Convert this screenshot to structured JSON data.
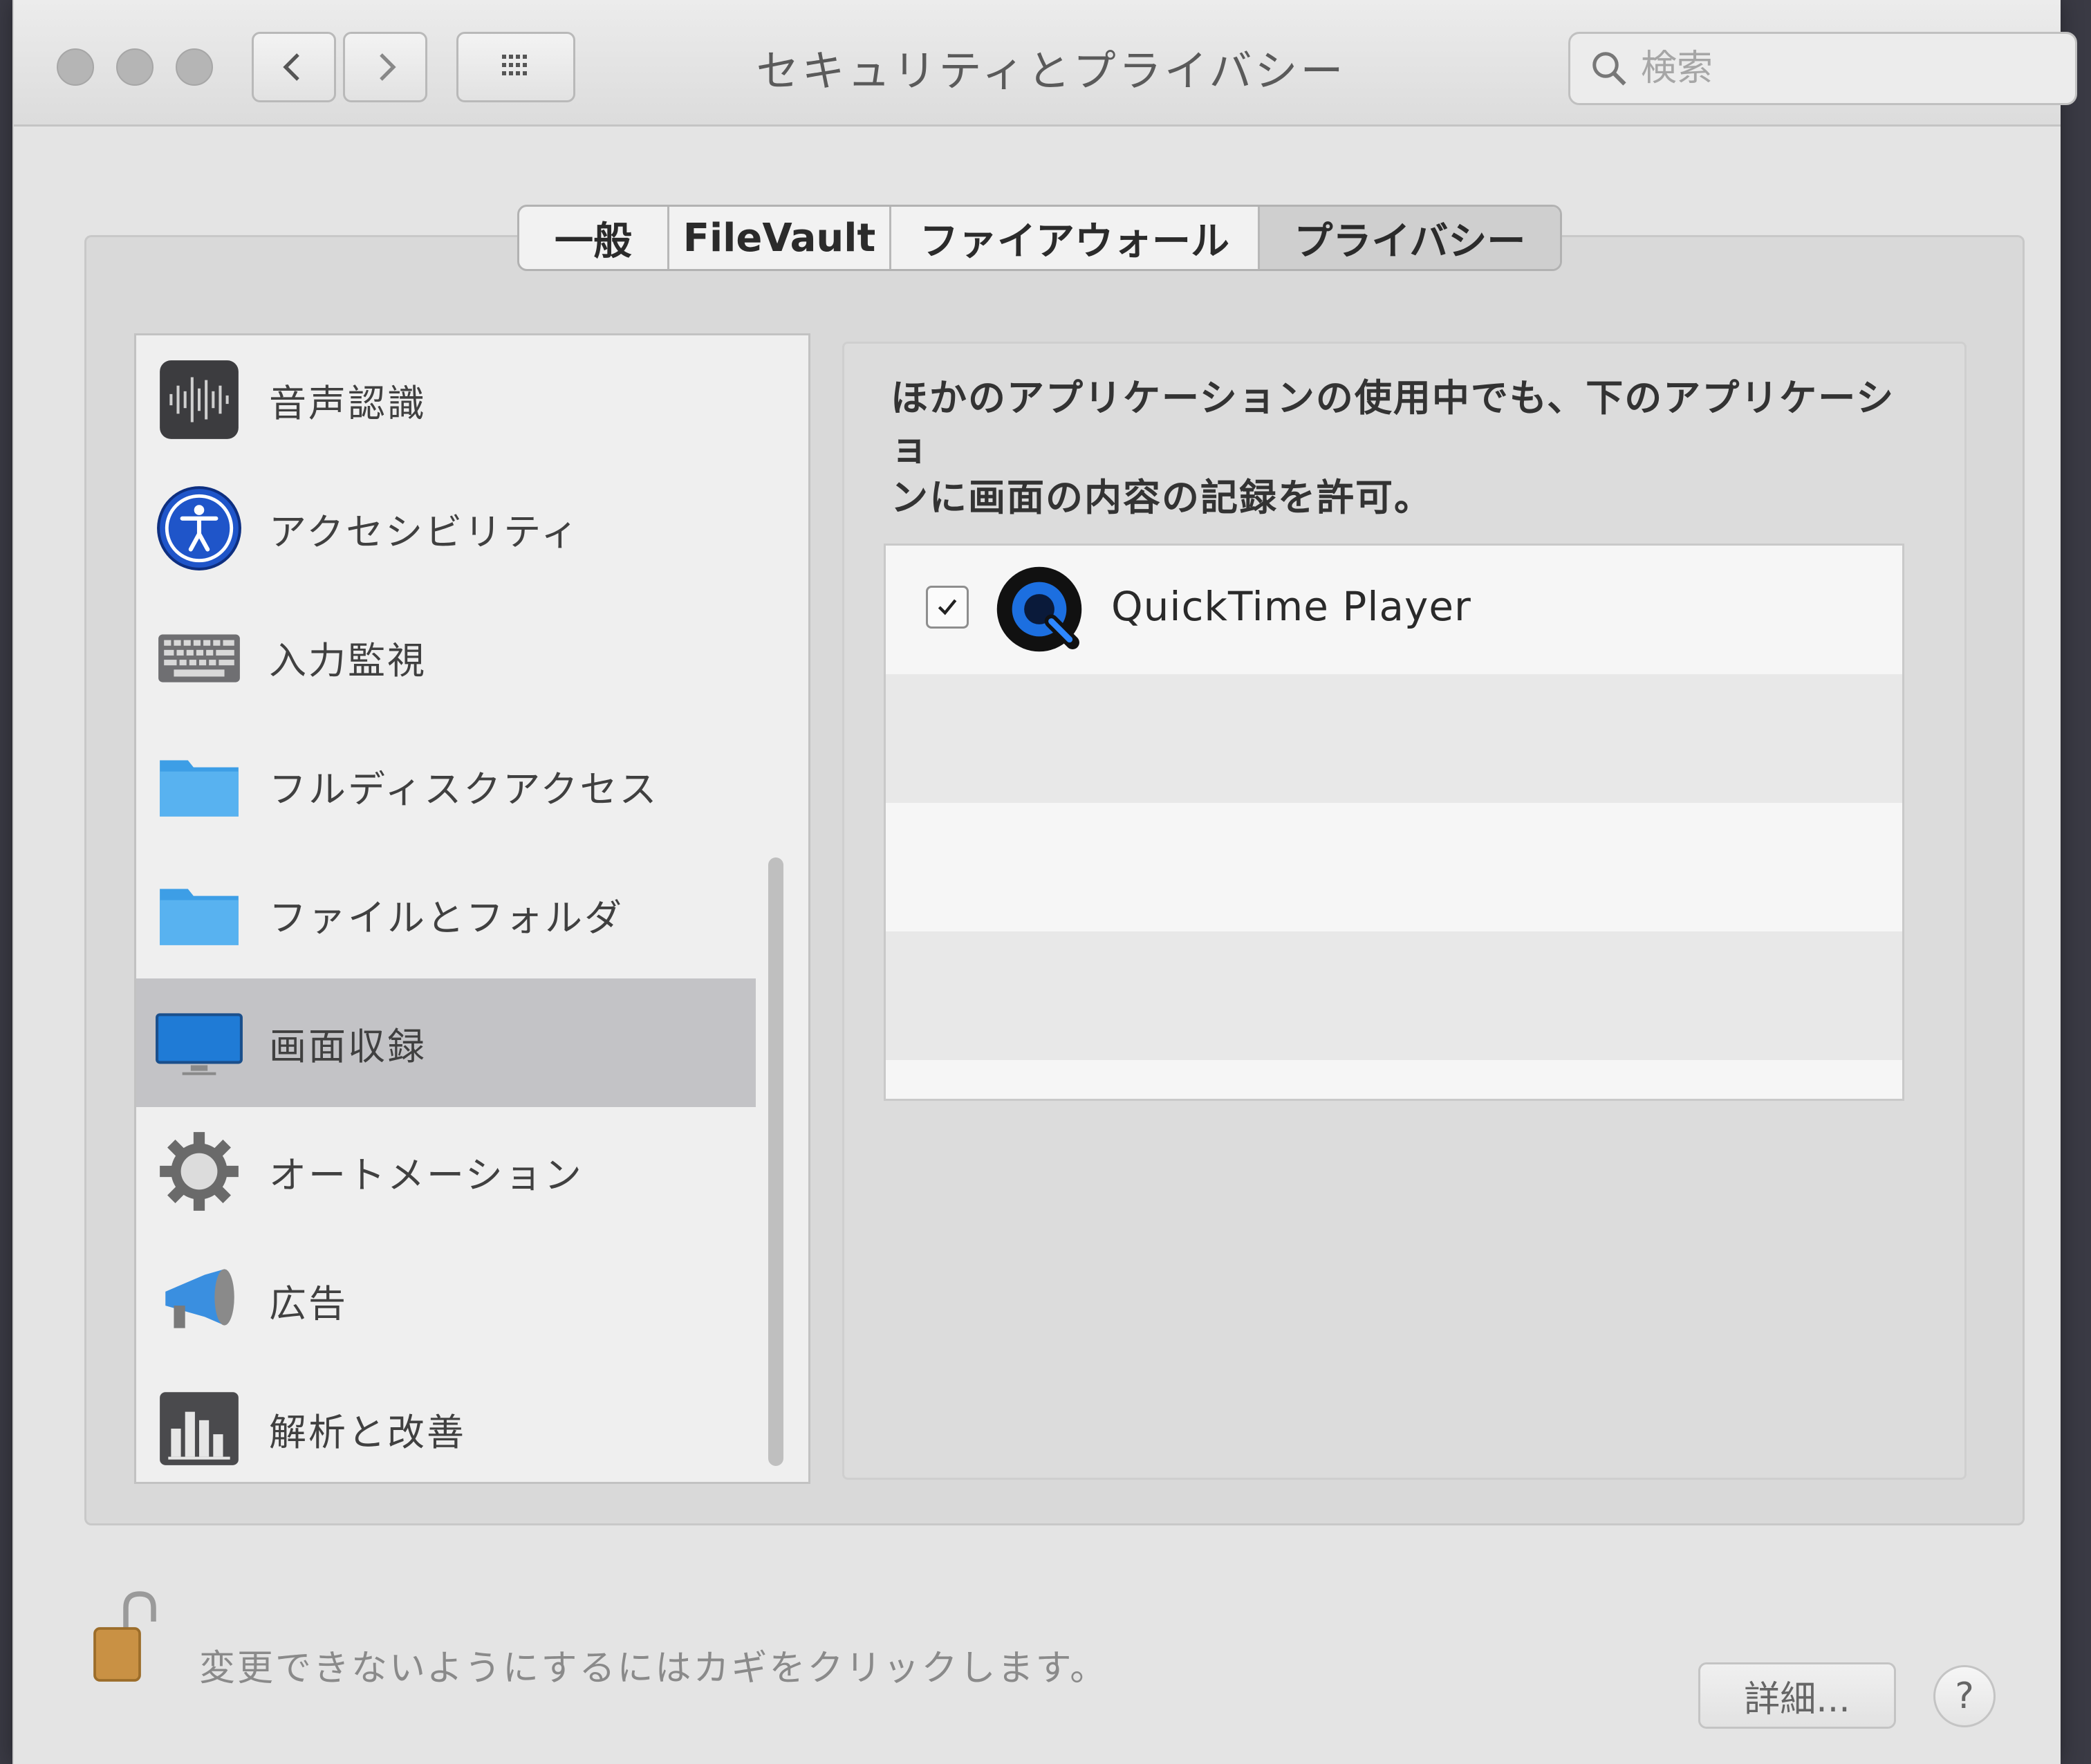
{
  "window": {
    "title": "セキュリティとプライバシー"
  },
  "search": {
    "placeholder": "検索"
  },
  "tabs": [
    {
      "label": "一般"
    },
    {
      "label": "FileVault"
    },
    {
      "label": "ファイアウォール"
    },
    {
      "label": "プライバシー",
      "selected": true
    }
  ],
  "sidebar": {
    "items": [
      {
        "label": "音声認識",
        "icon": "speech-recognition-icon"
      },
      {
        "label": "アクセシビリティ",
        "icon": "accessibility-icon"
      },
      {
        "label": "入力監視",
        "icon": "keyboard-icon"
      },
      {
        "label": "フルディスクアクセス",
        "icon": "folder-icon"
      },
      {
        "label": "ファイルとフォルダ",
        "icon": "folder-icon"
      },
      {
        "label": "画面収録",
        "icon": "display-icon",
        "selected": true
      },
      {
        "label": "オートメーション",
        "icon": "gear-icon"
      },
      {
        "label": "広告",
        "icon": "megaphone-icon"
      },
      {
        "label": "解析と改善",
        "icon": "chart-icon"
      }
    ]
  },
  "panel": {
    "description_line1": "ほかのアプリケーションの使用中でも、下のアプリケーショ",
    "description_line2": "ンに画面の内容の記録を許可。",
    "apps": [
      {
        "name": "QuickTime Player",
        "checked": true
      }
    ]
  },
  "footer": {
    "lock_text": "変更できないようにするにはカギをクリックします。",
    "advanced_label": "詳細...",
    "help_label": "?"
  },
  "colors": {
    "window_bg": "#e4e4e4",
    "selected_row": "#c3c3c6",
    "accent_blue": "#2a7fd4"
  }
}
